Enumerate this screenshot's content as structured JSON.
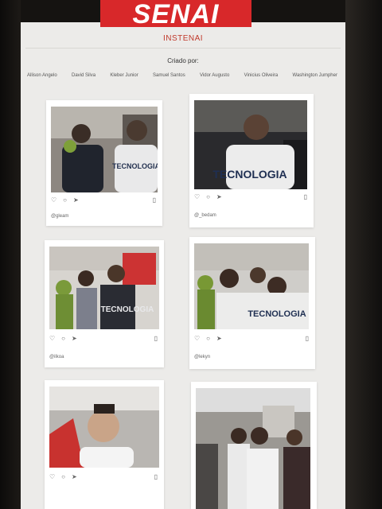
{
  "brand": {
    "logo_text": "SENAI"
  },
  "app": {
    "title": "INSTENAI"
  },
  "credits": {
    "label": "Criado por:",
    "authors": [
      "Allison Angelo",
      "David Silva",
      "Kleber Junior",
      "Samuel Santos",
      "Vidor Augusto",
      "Vinicius Oliveira",
      "Washington Jumpher"
    ]
  },
  "icons": {
    "like": "heart-icon",
    "comment": "comment-icon",
    "share": "send-icon",
    "save": "bookmark-icon"
  },
  "posts": [
    {
      "caption": "@gleam"
    },
    {
      "caption": "@_bedam"
    },
    {
      "caption": "@ilkoa"
    },
    {
      "caption": "@lekyn"
    },
    {
      "caption": ""
    },
    {
      "caption": ""
    }
  ],
  "banner_text": "TECNOLOGIA"
}
